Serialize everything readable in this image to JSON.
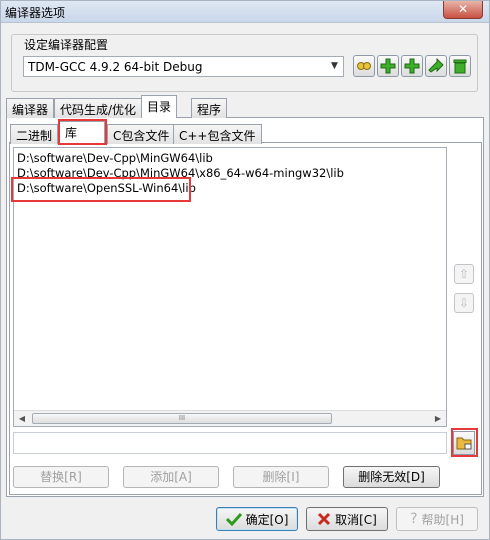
{
  "window": {
    "title": "编译器选项",
    "close_label": "✕"
  },
  "compiler_group": {
    "label": "设定编译器配置",
    "selected_profile": "TDM-GCC 4.9.2 64-bit Debug"
  },
  "toolbar_icons": [
    "edit-profile-icon",
    "add-profile-icon",
    "add-profile-alt-icon",
    "rename-profile-icon",
    "delete-profile-icon"
  ],
  "tabs": [
    {
      "label": "编译器"
    },
    {
      "label": "代码生成/优化"
    },
    {
      "label": "目录"
    },
    {
      "label": "程序"
    }
  ],
  "subtabs": [
    {
      "label": "二进制"
    },
    {
      "label": "库"
    },
    {
      "label": "C包含文件"
    },
    {
      "label": "C++包含文件"
    }
  ],
  "lib_dirs": [
    "D:\\software\\Dev-Cpp\\MinGW64\\lib",
    "D:\\software\\Dev-Cpp\\MinGW64\\x86_64-w64-mingw32\\lib",
    "D:\\software\\OpenSSL-Win64\\lib"
  ],
  "scroll_thumb_label": "III",
  "path_input_value": "",
  "actions": {
    "replace": "替换[R]",
    "add": "添加[A]",
    "delete": "删除[I]",
    "delete_invalid": "删除无效[D]"
  },
  "dialog": {
    "ok": "确定[O]",
    "cancel": "取消[C]",
    "help": "帮助[H]"
  },
  "colors": {
    "highlight": "#e8393a",
    "accent_green": "#3fae2a"
  }
}
